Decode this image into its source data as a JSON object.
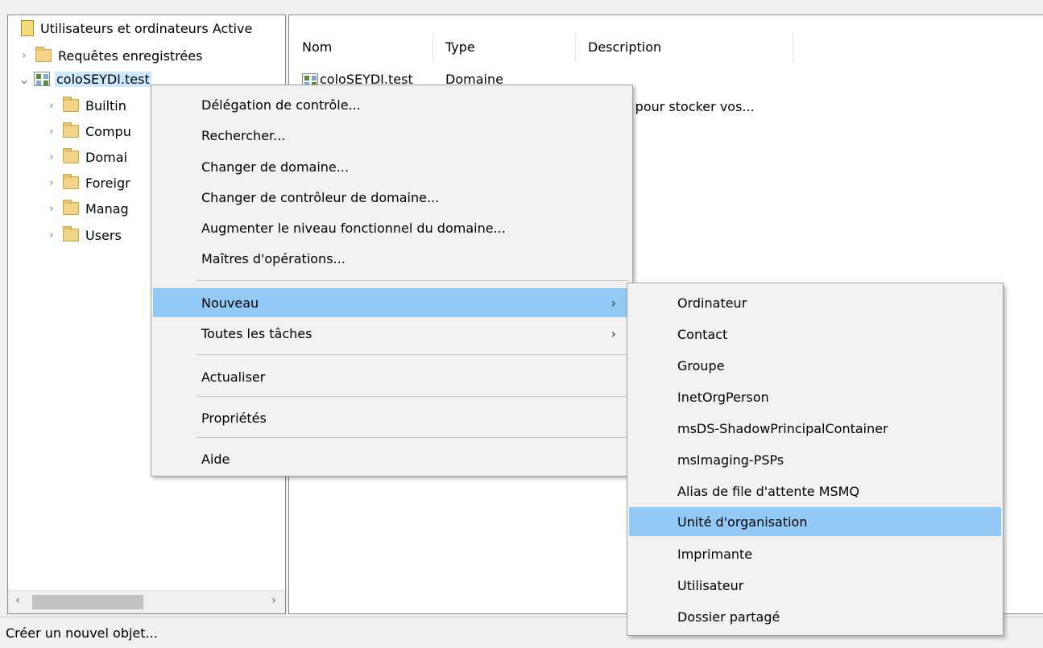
{
  "tree": {
    "root_label": "Utilisateurs et ordinateurs Active",
    "saved_queries": "Requêtes enregistrées",
    "domain": "coloSEYDI.test",
    "children": [
      "Builtin",
      "Compu",
      "Domai",
      "Foreigr",
      "Manag",
      "Users"
    ]
  },
  "list": {
    "columns": [
      "Nom",
      "Type",
      "Description"
    ],
    "row1": {
      "name": "coloSEYDI.test",
      "type": "Domaine"
    },
    "row2_desc_partial": "r pour stocker vos..."
  },
  "context_menu": {
    "items": [
      "Délégation de contrôle...",
      "Rechercher...",
      "Changer de domaine...",
      "Changer de contrôleur de domaine...",
      "Augmenter le niveau fonctionnel du domaine...",
      "Maîtres d'opérations...",
      "Nouveau",
      "Toutes les tâches",
      "Actualiser",
      "Propriétés",
      "Aide"
    ],
    "submenu_arrow": "›"
  },
  "submenu": {
    "items": [
      "Ordinateur",
      "Contact",
      "Groupe",
      "InetOrgPerson",
      "msDS-ShadowPrincipalContainer",
      "msImaging-PSPs",
      "Alias de file d'attente MSMQ",
      "Unité d'organisation",
      "Imprimante",
      "Utilisateur",
      "Dossier partagé"
    ]
  },
  "status": "Créer un nouvel objet...",
  "colors": {
    "highlight": "#91c9f7",
    "selected": "#cce8ff"
  },
  "icons": {
    "folder": "folder-icon",
    "domain": "domain-icon",
    "scroll_left": "‹",
    "scroll_right": "›",
    "expand": "›",
    "collapse": "⌄"
  }
}
